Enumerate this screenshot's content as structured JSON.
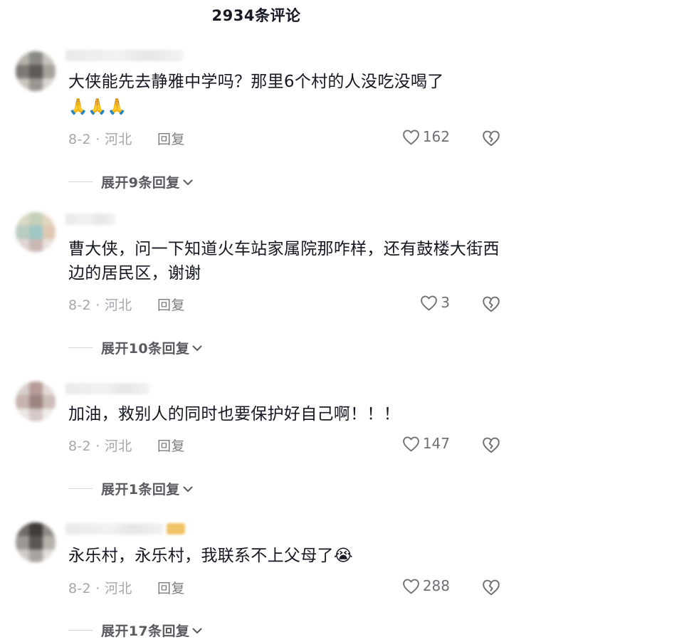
{
  "header": {
    "title": "2934条评论"
  },
  "comments": [
    {
      "text": "大侠能先去静雅中学吗？那里6个村的人没吃没喝了",
      "emojis": "🙏🙏🙏",
      "date_location": "8-2 · 河北",
      "reply_label": "回复",
      "likes": "162",
      "expand_label": "展开9条回复"
    },
    {
      "text": "曹大侠，问一下知道火车站家属院那咋样，还有鼓楼大街西边的居民区，谢谢",
      "emojis": "",
      "date_location": "8-2 · 河北",
      "reply_label": "回复",
      "likes": "3",
      "expand_label": "展开10条回复"
    },
    {
      "text": "加油，救别人的同时也要保护好自己啊！！！",
      "emojis": "",
      "date_location": "8-2 · 河北",
      "reply_label": "回复",
      "likes": "147",
      "expand_label": "展开1条回复"
    },
    {
      "text": "永乐村，永乐村，我联系不上父母了😭",
      "emojis": "",
      "date_location": "8-2 · 河北",
      "reply_label": "回复",
      "likes": "288",
      "expand_label": "展开17条回复"
    }
  ],
  "icons": {
    "like": "heart-outline-icon",
    "dislike": "broken-heart-icon",
    "expand": "chevron-down-icon"
  },
  "colors": {
    "text": "#161823",
    "meta": "#a6a7ab",
    "reply": "#7b7c80",
    "expand": "#5a5b60"
  }
}
